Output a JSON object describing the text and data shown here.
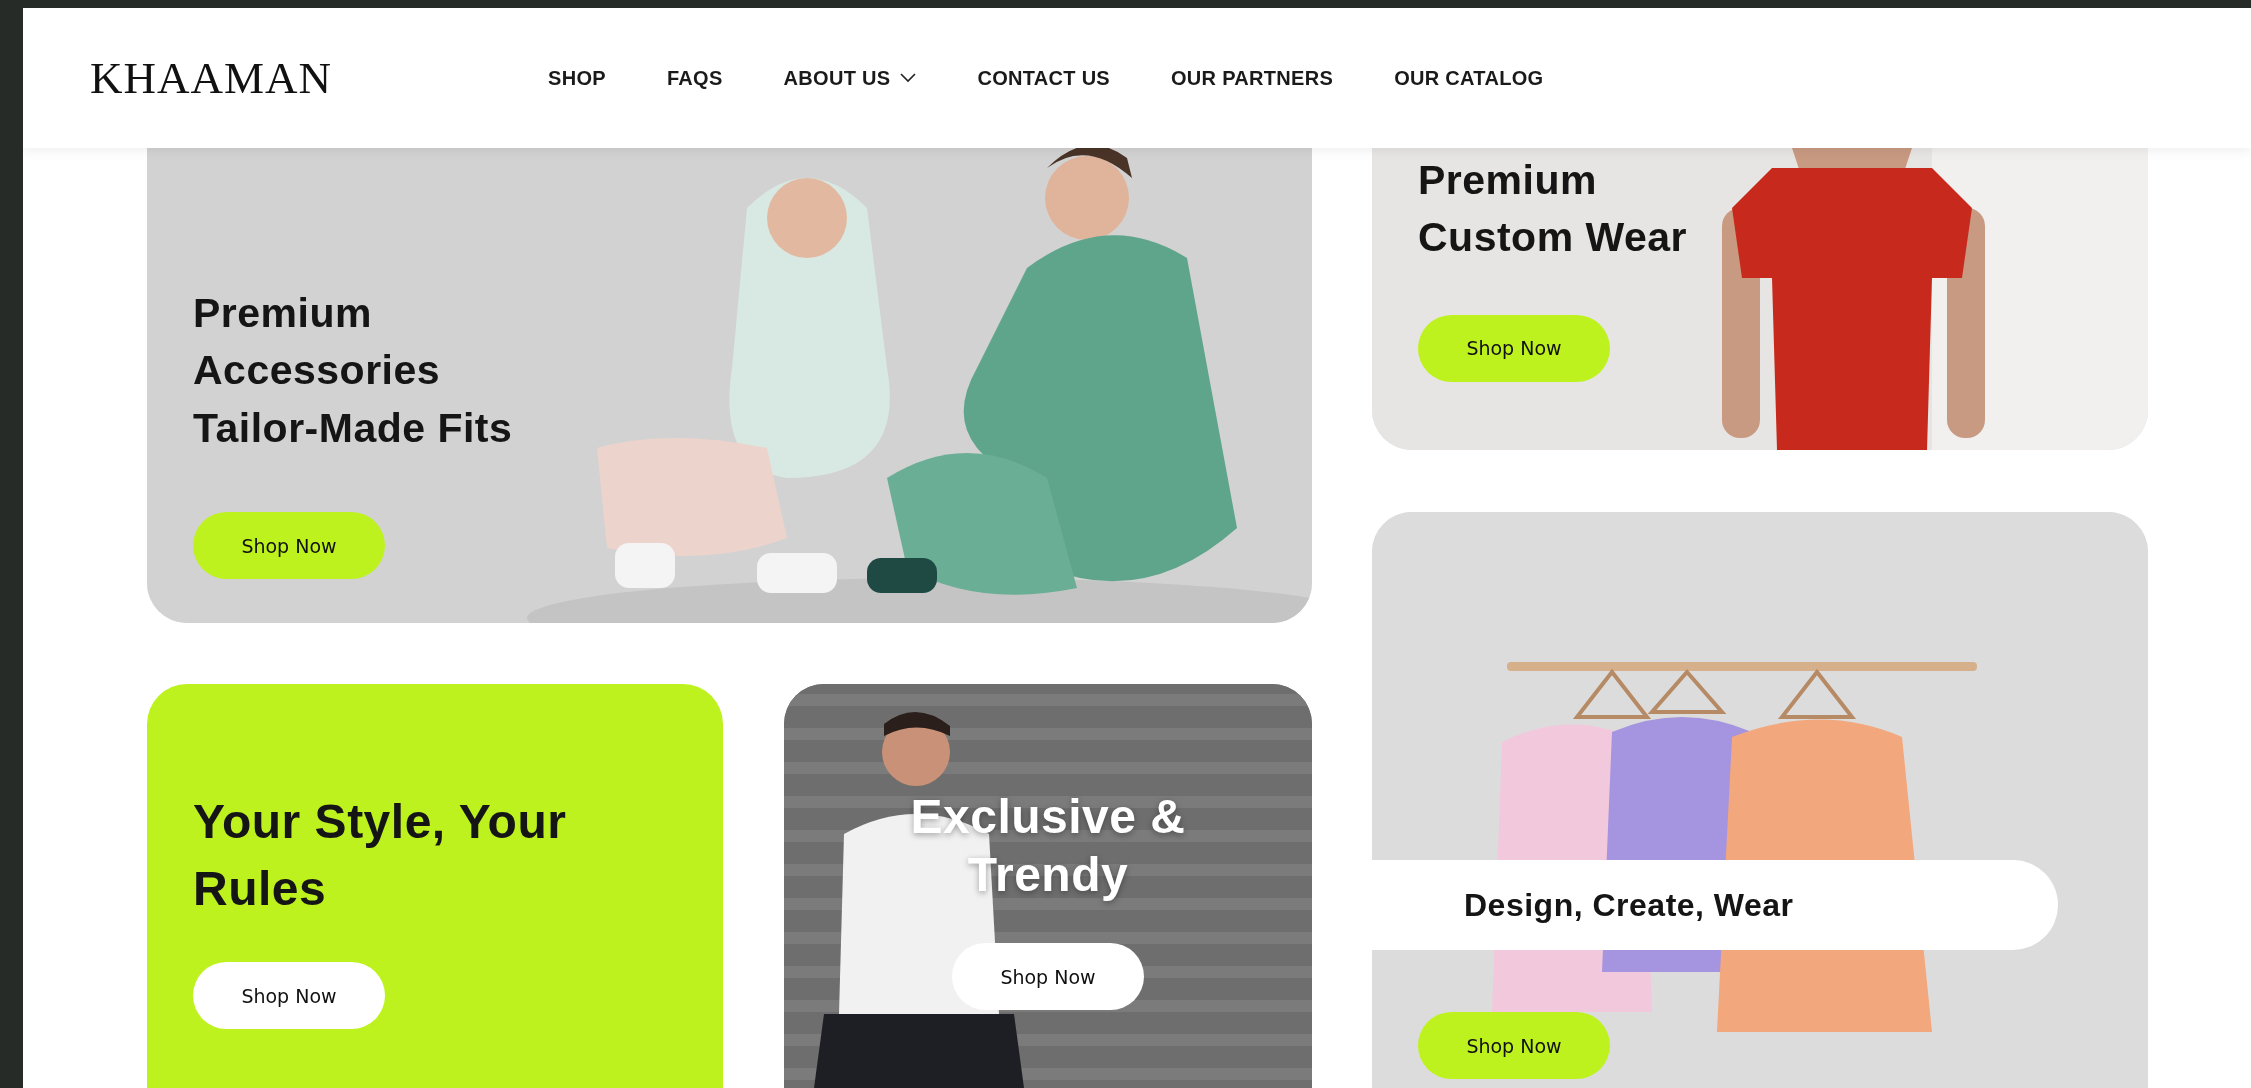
{
  "brand": "KHAAMAN",
  "nav": [
    {
      "label": "SHOP",
      "dropdown": false
    },
    {
      "label": "FAQS",
      "dropdown": false
    },
    {
      "label": "ABOUT US",
      "dropdown": true
    },
    {
      "label": "CONTACT US",
      "dropdown": false
    },
    {
      "label": "OUR PARTNERS",
      "dropdown": false
    },
    {
      "label": "OUR CATALOG",
      "dropdown": false
    }
  ],
  "cards": [
    {
      "title": "Premium\nAccessories\nTailor-Made Fits",
      "button": "Shop Now"
    },
    {
      "kind": "accent",
      "title": "Your Style, Your\nRules",
      "button": "Shop Now"
    },
    {
      "kind": "dark",
      "title": "Exclusive &\nTrendy",
      "button": "Shop Now"
    },
    {
      "title": "Premium\nCustom Wear",
      "button": "Shop Now"
    },
    {
      "kind": "caption",
      "title": "Design, Create, Wear",
      "button": "Shop Now"
    }
  ]
}
